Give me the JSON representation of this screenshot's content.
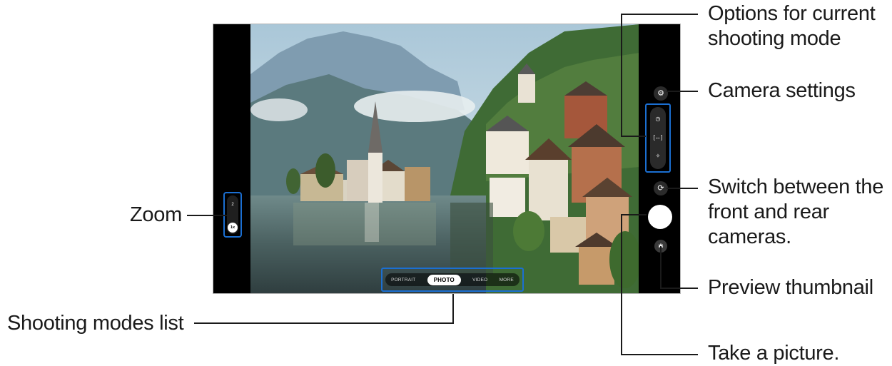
{
  "viewfinder": {
    "description_hidden": ""
  },
  "zoom": {
    "level_2": "2",
    "level_1x": "1x"
  },
  "modes": {
    "items": [
      "PORTRAIT",
      "PHOTO",
      "VIDEO",
      "MORE"
    ],
    "selected": "PHOTO"
  },
  "controls": {
    "settings_icon": "gear-icon",
    "options_icons": [
      "timer-icon",
      "aspect-ratio-icon",
      "filter-effects-icon"
    ],
    "switch_icon": "camera-switch-icon",
    "shutter_icon": "shutter-button",
    "thumbnail_icon": "preview-thumbnail-icon"
  },
  "callouts": {
    "zoom": "Zoom",
    "shooting_modes": "Shooting modes list",
    "options_line1": "Options for current",
    "options_line2": "shooting mode",
    "camera_settings": "Camera settings",
    "switch_line1": "Switch between the",
    "switch_line2": "front and rear",
    "switch_line3": "cameras.",
    "preview_thumbnail": "Preview thumbnail",
    "take_picture": "Take a picture."
  },
  "colors": {
    "highlight_box": "#1b6fd2",
    "lines": "#1a1a1a"
  }
}
